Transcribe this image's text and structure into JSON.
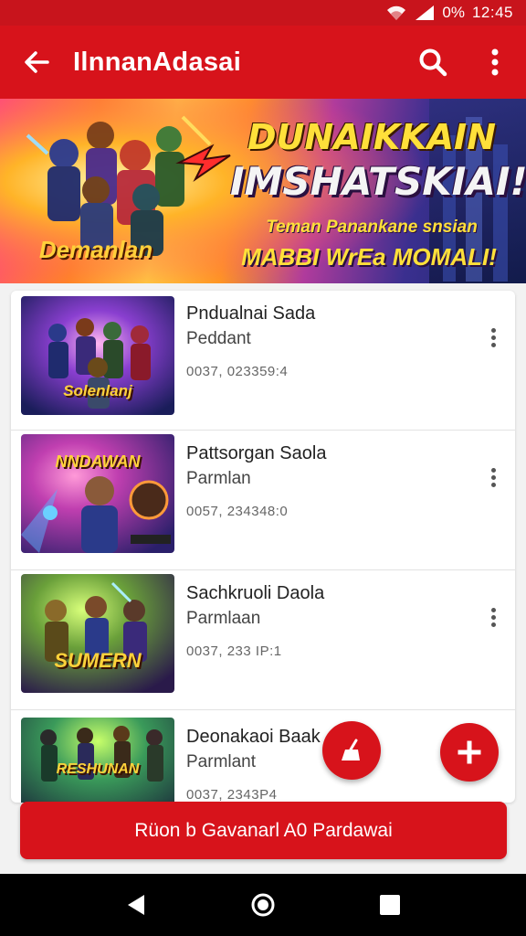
{
  "status_bar": {
    "battery": "0%",
    "time": "12:45"
  },
  "app_bar": {
    "title": "IlnnanAdasai"
  },
  "banner": {
    "title": "DUNAIKKAIN",
    "subtitle": "IMSHATSKIAI!",
    "tagline": "Teman Panankane snsian",
    "tagline2": "MABBI WrEa MOMALI!",
    "logo": "Demanlan"
  },
  "list": {
    "items": [
      {
        "title": "Pndualnai  Sada",
        "subtitle": "Peddant",
        "meta": "0037, 023359:4",
        "thumb_label": "Solenlanj"
      },
      {
        "title": "Pattsorgan Saola",
        "subtitle": "Parmlan",
        "meta": "0057, 234348:0",
        "thumb_label": "NNDAWAN"
      },
      {
        "title": "Sachkruoli Daola",
        "subtitle": "Parmlaan",
        "meta": "0037, 233 IP:1",
        "thumb_label": "SUMERN"
      },
      {
        "title": "Deonakaoi Baak",
        "subtitle": "Parmlant",
        "meta": "0037, 2343P4",
        "thumb_label": "RESHUNAN"
      }
    ]
  },
  "cta": {
    "label": "Rüon b Gavanarl A0 Pardawai"
  },
  "colors": {
    "primary": "#d7131b",
    "status": "#c8141c"
  },
  "icons": {
    "back": "arrow-left-icon",
    "search": "search-icon",
    "more": "more-vert-icon",
    "fab_secondary": "broom-icon",
    "fab_primary": "plus-icon"
  }
}
